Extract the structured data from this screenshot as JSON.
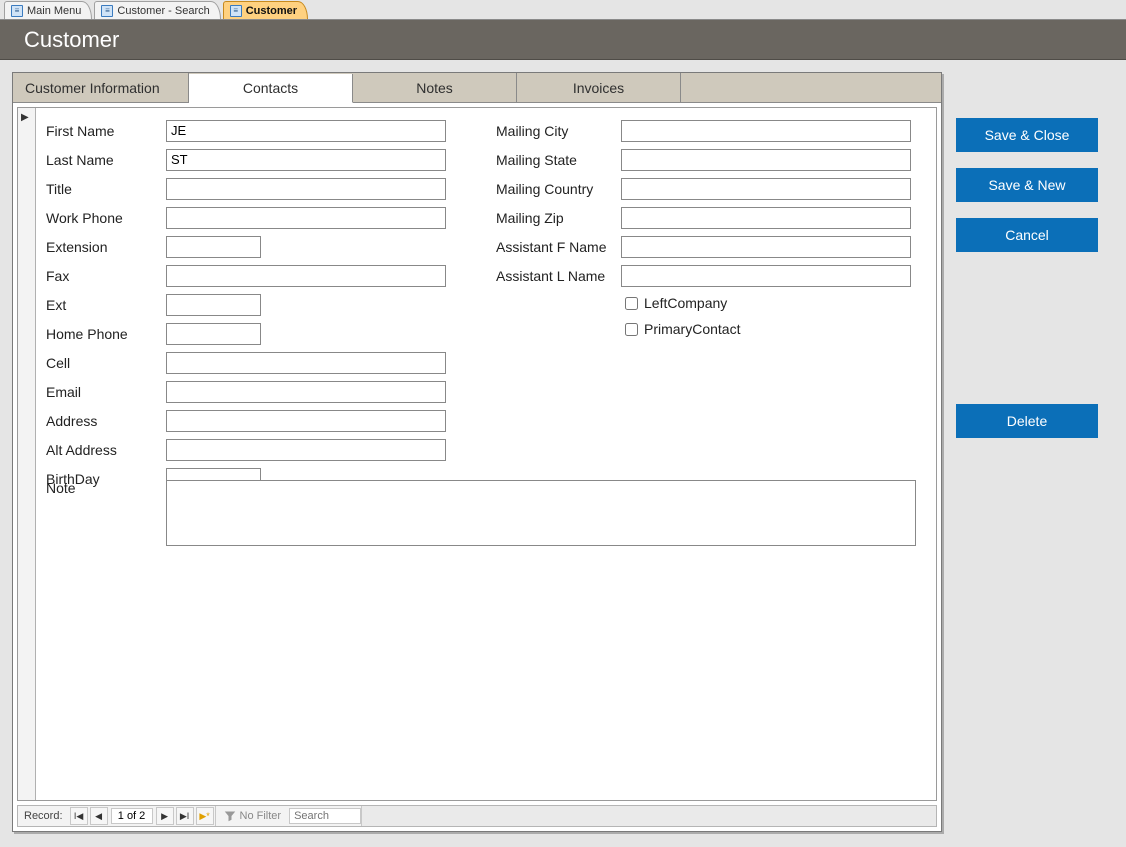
{
  "docTabs": [
    {
      "label": "Main Menu",
      "active": false
    },
    {
      "label": "Customer - Search",
      "active": false
    },
    {
      "label": "Customer",
      "active": true
    }
  ],
  "titleBar": {
    "title": "Customer"
  },
  "innerTabs": {
    "customerInfo": "Customer Information",
    "contacts": "Contacts",
    "notes": "Notes",
    "invoices": "Invoices",
    "active": "contacts"
  },
  "fields": {
    "left": {
      "firstName": {
        "label": "First Name",
        "value": "JE",
        "width": "full"
      },
      "lastName": {
        "label": "Last Name",
        "value": "ST",
        "width": "full"
      },
      "title": {
        "label": "Title",
        "value": "",
        "width": "full"
      },
      "workPhone": {
        "label": "Work Phone",
        "value": "",
        "width": "full"
      },
      "extension": {
        "label": "Extension",
        "value": "",
        "width": "short"
      },
      "fax": {
        "label": "Fax",
        "value": "",
        "width": "full"
      },
      "ext": {
        "label": "Ext",
        "value": "",
        "width": "short"
      },
      "homePhone": {
        "label": "Home Phone",
        "value": "",
        "width": "short"
      },
      "cell": {
        "label": "Cell",
        "value": "",
        "width": "full"
      },
      "email": {
        "label": "Email",
        "value": "",
        "width": "full"
      },
      "address": {
        "label": "Address",
        "value": "",
        "width": "full"
      },
      "altAddress": {
        "label": "Alt Address",
        "value": "",
        "width": "full"
      },
      "birthday": {
        "label": "BirthDay",
        "value": "",
        "width": "short"
      }
    },
    "right": {
      "mailingCity": {
        "label": "Mailing City",
        "value": ""
      },
      "mailingState": {
        "label": "Mailing State",
        "value": ""
      },
      "mailingCountry": {
        "label": "Mailing Country",
        "value": ""
      },
      "mailingZip": {
        "label": "Mailing Zip",
        "value": ""
      },
      "assistantFName": {
        "label": "Assistant F Name",
        "value": ""
      },
      "assistantLName": {
        "label": "Assistant L Name",
        "value": ""
      }
    },
    "checks": {
      "leftCompany": {
        "label": "LeftCompany",
        "checked": false
      },
      "primaryContact": {
        "label": "PrimaryContact",
        "checked": false
      }
    },
    "note": {
      "label": "Note",
      "value": ""
    }
  },
  "recordNav": {
    "label": "Record:",
    "position": "1 of 2",
    "filterLabel": "No Filter",
    "searchPlaceholder": "Search"
  },
  "sideButtons": {
    "saveClose": "Save & Close",
    "saveNew": "Save & New",
    "cancel": "Cancel",
    "delete": "Delete"
  }
}
